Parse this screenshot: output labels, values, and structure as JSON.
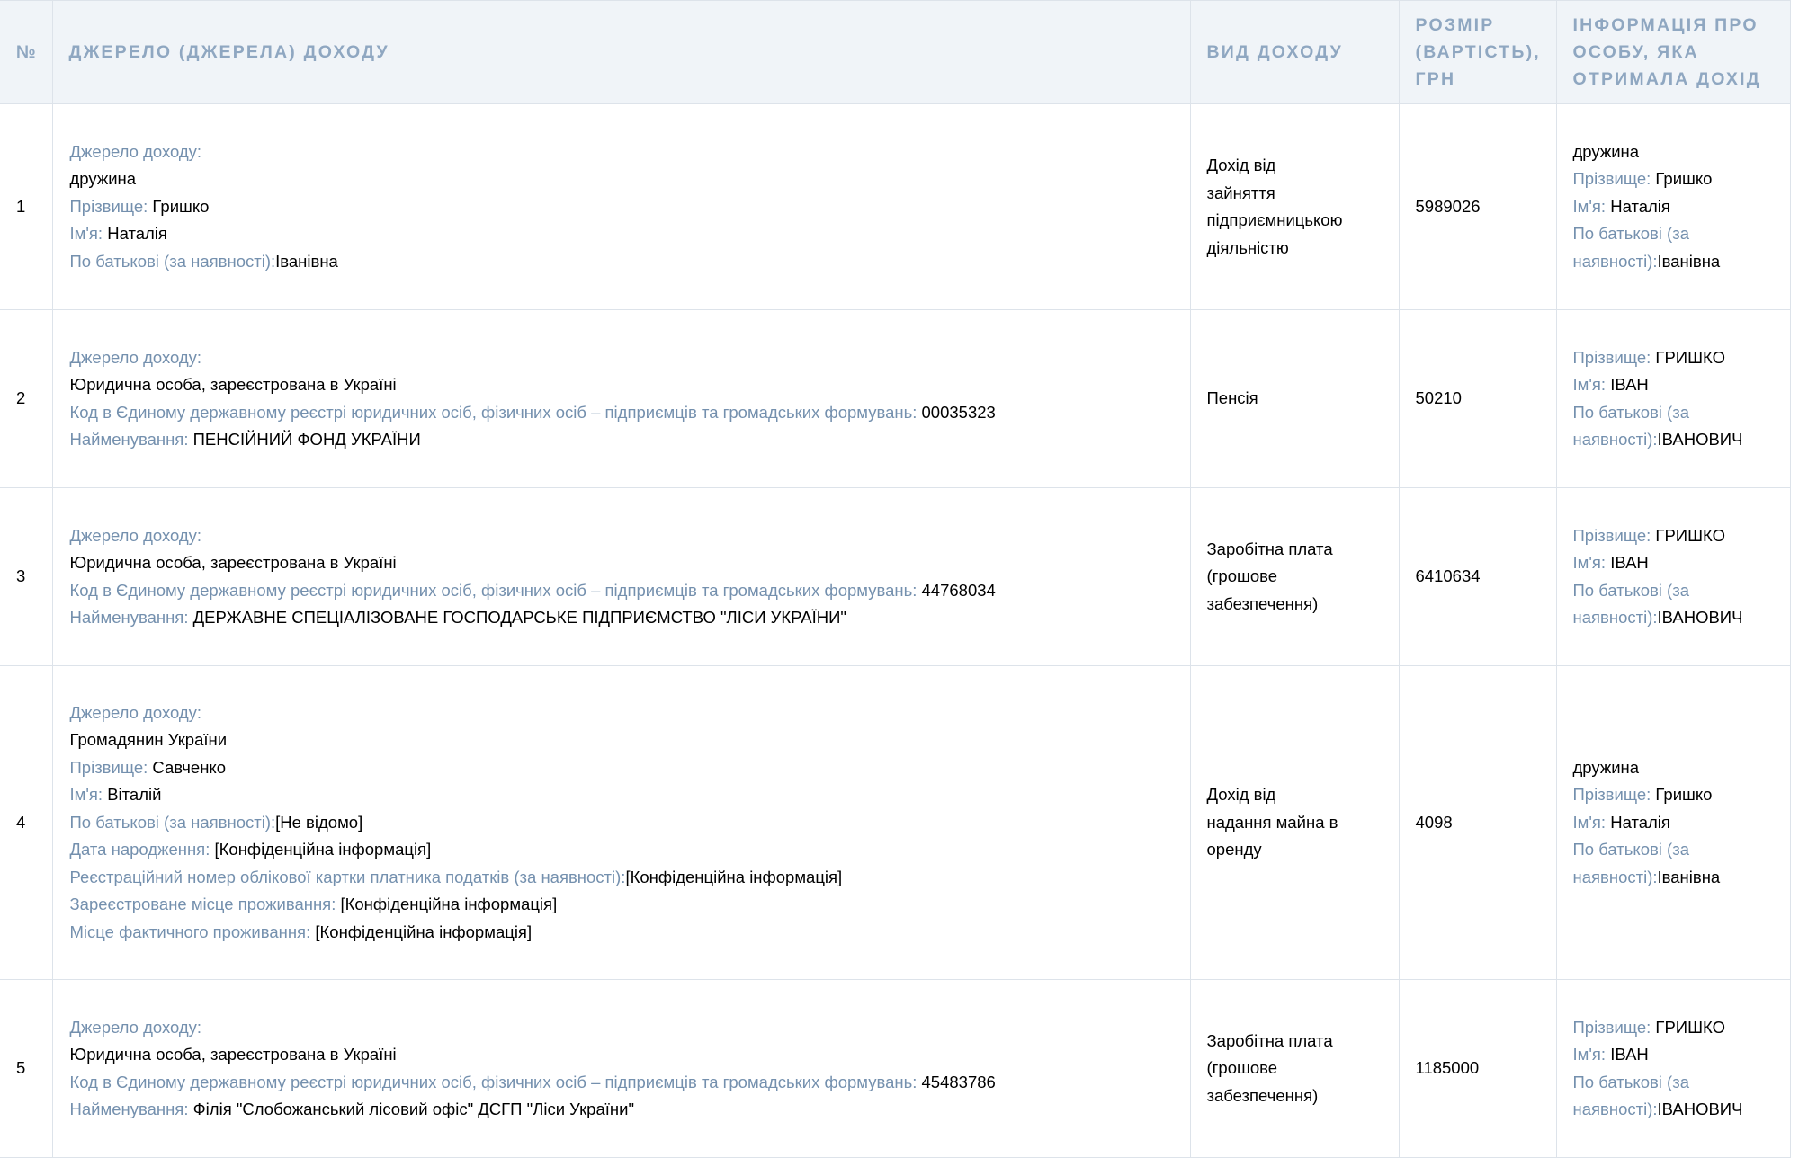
{
  "headers": {
    "num": "№",
    "source": "ДЖЕРЕЛО (ДЖЕРЕЛА) ДОХОДУ",
    "type": "ВИД ДОХОДУ",
    "amount": "РОЗМІР (ВАРТІСТЬ), ГРН",
    "person": "ІНФОРМАЦІЯ ПРО ОСОБУ, ЯКА ОТРИМАЛА ДОХІД"
  },
  "labels": {
    "source_of_income": "Джерело доходу:",
    "surname": "Прізвище: ",
    "name": "Ім'я: ",
    "patronymic": "По батькові (за наявності):",
    "patronymic_a": "По батькові (за",
    "patronymic_b": "наявності):",
    "edr_code": "Код в Єдиному державному реєстрі юридичних осіб, фізичних осіб – підприємців та громадських формувань: ",
    "org_name": "Найменування: ",
    "birth_date": "Дата народження: ",
    "tax_number": "Реєстраційний номер облікової картки платника податків (за наявності):",
    "registered_address": "Зареєстроване місце проживання: ",
    "actual_address": "Місце фактичного проживання: "
  },
  "rows": [
    {
      "num": "1",
      "source": {
        "kind": "дружина",
        "surname": "Гришко",
        "name": "Наталія",
        "patronymic": "Іванівна"
      },
      "type_lines": [
        "Дохід від",
        "зайняття",
        "підприємницькою",
        "діяльністю"
      ],
      "amount": "5989026",
      "person": {
        "relation": "дружина",
        "surname": "Гришко",
        "name": "Наталія",
        "patronymic": "Іванівна"
      }
    },
    {
      "num": "2",
      "source": {
        "kind": "Юридична особа, зареєстрована в Україні",
        "code": "00035323",
        "org_name": "ПЕНСІЙНИЙ ФОНД УКРАЇНИ"
      },
      "type_lines": [
        "Пенсія"
      ],
      "amount": "50210",
      "person": {
        "surname": "ГРИШКО",
        "name": "ІВАН",
        "patronymic": "ІВАНОВИЧ"
      }
    },
    {
      "num": "3",
      "source": {
        "kind": "Юридична особа, зареєстрована в Україні",
        "code": "44768034",
        "org_name": "ДЕРЖАВНЕ СПЕЦІАЛІЗОВАНЕ ГОСПОДАРСЬКЕ ПІДПРИЄМСТВО \"ЛІСИ УКРАЇНИ\""
      },
      "type_lines": [
        "Заробітна плата",
        "(грошове",
        "забезпечення)"
      ],
      "amount": "6410634",
      "person": {
        "surname": "ГРИШКО",
        "name": "ІВАН",
        "patronymic": "ІВАНОВИЧ"
      }
    },
    {
      "num": "4",
      "source": {
        "kind": "Громадянин України",
        "surname": "Савченко",
        "name": "Віталій",
        "patronymic": "[Не відомо]",
        "birth_date": "[Конфіденційна інформація]",
        "tax_number": "[Конфіденційна інформація]",
        "registered_address": "[Конфіденційна інформація]",
        "actual_address": "[Конфіденційна інформація]"
      },
      "type_lines": [
        "Дохід від",
        "надання майна в",
        "оренду"
      ],
      "amount": "4098",
      "person": {
        "relation": "дружина",
        "surname": "Гришко",
        "name": "Наталія",
        "patronymic": "Іванівна"
      }
    },
    {
      "num": "5",
      "source": {
        "kind": "Юридична особа, зареєстрована в Україні",
        "code": "45483786",
        "org_name": "Філія \"Слобожанський лісовий офіс\" ДСГП \"Ліси України\""
      },
      "type_lines": [
        "Заробітна плата",
        "(грошове",
        "забезпечення)"
      ],
      "amount": "1185000",
      "person": {
        "surname": "ГРИШКО",
        "name": "ІВАН",
        "patronymic": "ІВАНОВИЧ"
      }
    }
  ]
}
